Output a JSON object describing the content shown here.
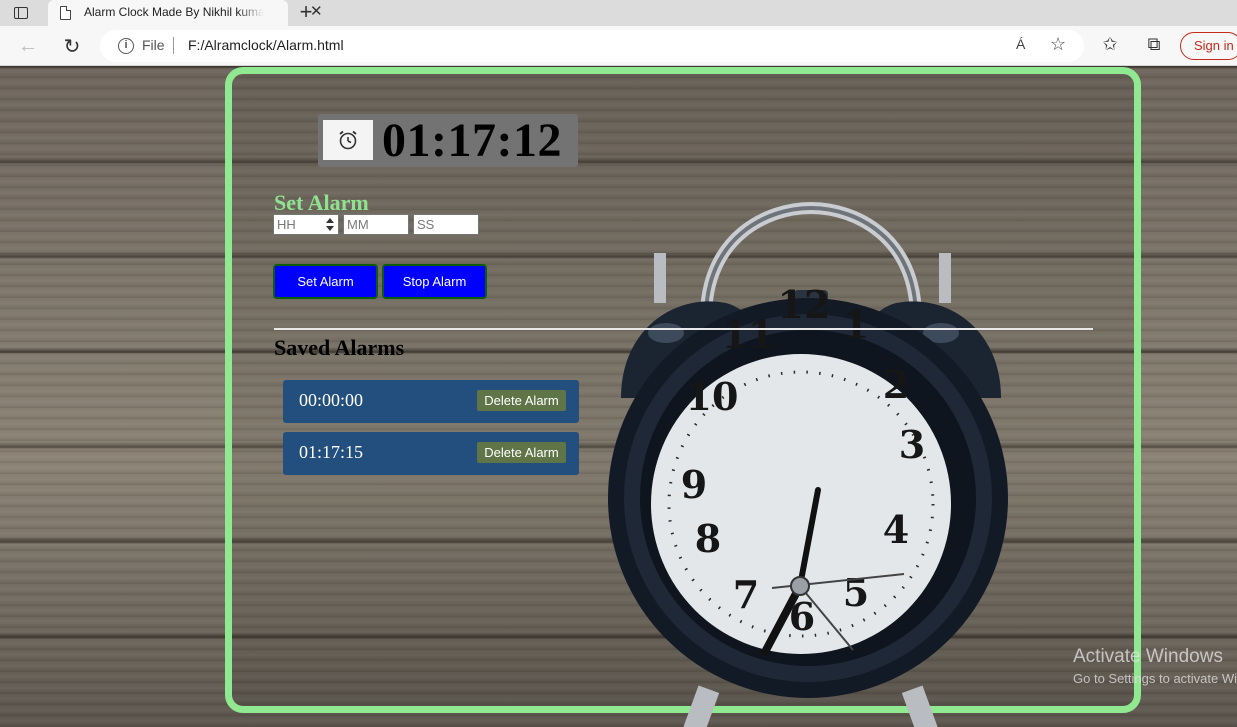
{
  "browser": {
    "tab_title": "Alarm Clock Made By Nikhil kumar",
    "tab_close": "✕",
    "new_tab": "+",
    "url_scheme_label": "File",
    "url": "F:/Alramclock/Alarm.html",
    "read_aloud": "Á",
    "sign_in": "Sign in",
    "icons": [
      "tab-actions-icon",
      "page-icon",
      "back-icon",
      "reload-icon",
      "info-icon",
      "read-aloud-icon",
      "add-favorite-icon",
      "favorites-icon",
      "collections-icon"
    ]
  },
  "page": {
    "current_time": "01:17:12",
    "set_alarm_heading": "Set Alarm",
    "inputs": {
      "hh_placeholder": "HH",
      "mm_placeholder": "MM",
      "ss_placeholder": "SS"
    },
    "buttons": {
      "set_alarm": "Set Alarm",
      "stop_alarm": "Stop Alarm"
    },
    "saved_heading": "Saved Alarms",
    "saved_alarms": [
      {
        "time": "00:00:00",
        "delete_label": "Delete Alarm"
      },
      {
        "time": "01:17:15",
        "delete_label": "Delete Alarm"
      }
    ]
  },
  "clock_numerals": [
    "12",
    "1",
    "2",
    "3",
    "4",
    "5",
    "6",
    "7",
    "8",
    "9",
    "10",
    "11"
  ],
  "watermark": {
    "line1": "Activate Windows",
    "line2": "Go to Settings to activate Windows."
  },
  "colors": {
    "frame_border": "#90e890",
    "heading_green": "#8fe28f",
    "button_blue": "#0000ff",
    "alarm_row": "#234f7e",
    "delete_button": "#5f7447"
  }
}
